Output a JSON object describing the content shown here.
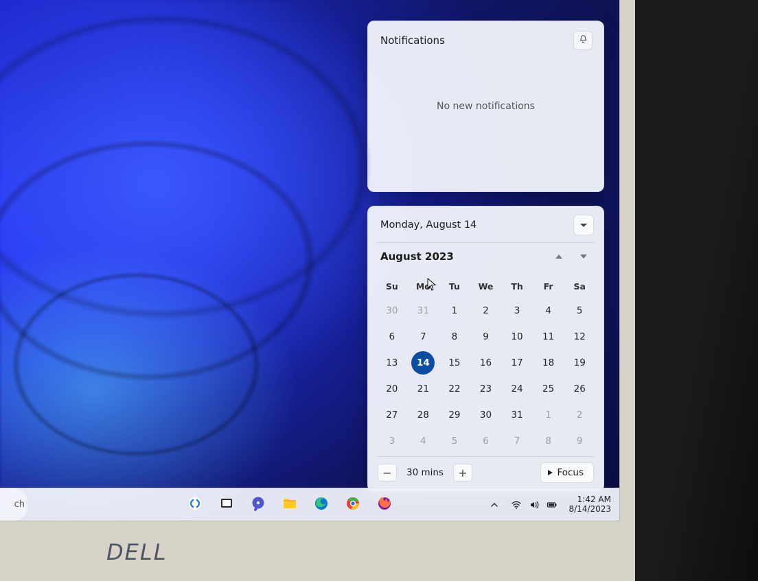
{
  "monitor_brand": "DELL",
  "taskbar": {
    "search_fragment": "ch",
    "tray": {
      "time": "1:42 AM",
      "date": "8/14/2023"
    }
  },
  "notifications": {
    "title": "Notifications",
    "empty_message": "No new notifications"
  },
  "calendar": {
    "full_date": "Monday, August 14",
    "month_year": "August 2023",
    "weekdays": [
      "Su",
      "Mo",
      "Tu",
      "We",
      "Th",
      "Fr",
      "Sa"
    ],
    "days": [
      {
        "n": "30",
        "t": "other"
      },
      {
        "n": "31",
        "t": "other"
      },
      {
        "n": "1",
        "t": "cur"
      },
      {
        "n": "2",
        "t": "cur"
      },
      {
        "n": "3",
        "t": "cur"
      },
      {
        "n": "4",
        "t": "cur"
      },
      {
        "n": "5",
        "t": "cur"
      },
      {
        "n": "6",
        "t": "cur"
      },
      {
        "n": "7",
        "t": "cur"
      },
      {
        "n": "8",
        "t": "cur"
      },
      {
        "n": "9",
        "t": "cur"
      },
      {
        "n": "10",
        "t": "cur"
      },
      {
        "n": "11",
        "t": "cur"
      },
      {
        "n": "12",
        "t": "cur"
      },
      {
        "n": "13",
        "t": "cur"
      },
      {
        "n": "14",
        "t": "sel"
      },
      {
        "n": "15",
        "t": "cur"
      },
      {
        "n": "16",
        "t": "cur"
      },
      {
        "n": "17",
        "t": "cur"
      },
      {
        "n": "18",
        "t": "cur"
      },
      {
        "n": "19",
        "t": "cur"
      },
      {
        "n": "20",
        "t": "cur"
      },
      {
        "n": "21",
        "t": "cur"
      },
      {
        "n": "22",
        "t": "cur"
      },
      {
        "n": "23",
        "t": "cur"
      },
      {
        "n": "24",
        "t": "cur"
      },
      {
        "n": "25",
        "t": "cur"
      },
      {
        "n": "26",
        "t": "cur"
      },
      {
        "n": "27",
        "t": "cur"
      },
      {
        "n": "28",
        "t": "cur"
      },
      {
        "n": "29",
        "t": "cur"
      },
      {
        "n": "30",
        "t": "cur"
      },
      {
        "n": "31",
        "t": "cur"
      },
      {
        "n": "1",
        "t": "other"
      },
      {
        "n": "2",
        "t": "other"
      },
      {
        "n": "3",
        "t": "other"
      },
      {
        "n": "4",
        "t": "other"
      },
      {
        "n": "5",
        "t": "other"
      },
      {
        "n": "6",
        "t": "other"
      },
      {
        "n": "7",
        "t": "other"
      },
      {
        "n": "8",
        "t": "other"
      },
      {
        "n": "9",
        "t": "other"
      }
    ],
    "focus": {
      "duration_label": "30 mins",
      "button_label": "Focus"
    }
  }
}
